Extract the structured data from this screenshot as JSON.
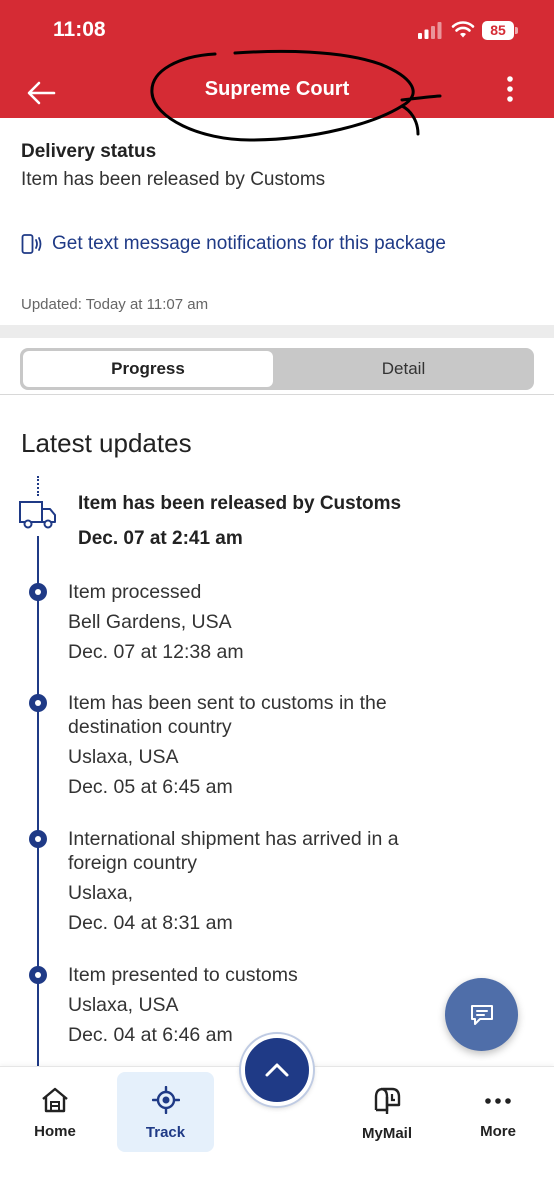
{
  "status_bar": {
    "time": "11:08",
    "battery": "85"
  },
  "header": {
    "title": "Supreme Court",
    "back_icon": "arrow-left-icon",
    "menu_icon": "more-vertical-icon",
    "color": "#d52b34"
  },
  "delivery": {
    "label": "Delivery status",
    "status": "Item has been released by Customs",
    "notification_link": "Get text message notifications for this package",
    "updated": "Updated: Today at 11:07 am"
  },
  "tabs": [
    {
      "label": "Progress",
      "selected": true
    },
    {
      "label": "Detail",
      "selected": false
    }
  ],
  "timeline": {
    "heading": "Latest updates",
    "latest": {
      "title": "Item has been released by Customs",
      "date": "Dec. 07 at 2:41 am"
    },
    "events": [
      {
        "title": "Item processed",
        "location": "Bell Gardens, USA",
        "date": "Dec. 07 at 12:38 am"
      },
      {
        "title": "Item has been sent to customs in the destination country",
        "location": "Uslaxa, USA",
        "date": "Dec. 05 at 6:45 am"
      },
      {
        "title": "International shipment has arrived in a foreign country",
        "location": "Uslaxa,",
        "date": "Dec. 04 at 8:31 am"
      },
      {
        "title": "Item presented to customs",
        "location": "Uslaxa, USA",
        "date": "Dec. 04 at 6:46 am"
      }
    ]
  },
  "bottom_nav": {
    "items": [
      {
        "label": "Home",
        "icon": "home-icon"
      },
      {
        "label": "Track",
        "icon": "track-icon",
        "active": true
      },
      {
        "label": "MyMail",
        "icon": "mailbox-icon"
      },
      {
        "label": "More",
        "icon": "more-horizontal-icon"
      }
    ]
  },
  "colors": {
    "accent_blue": "#1f3a86",
    "fab_blue": "#4f6ea9"
  }
}
